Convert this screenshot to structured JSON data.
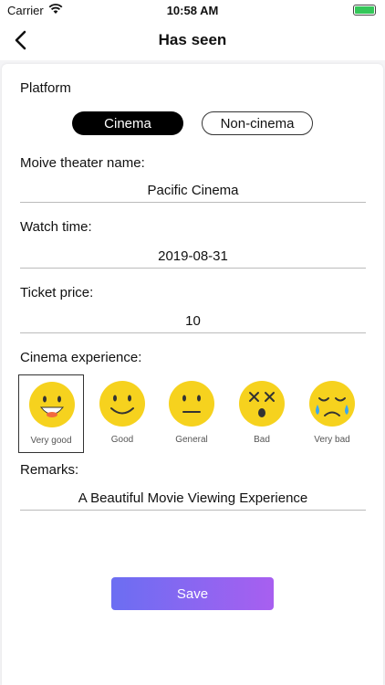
{
  "status": {
    "carrier": "Carrier",
    "time": "10:58 AM"
  },
  "nav": {
    "title": "Has seen"
  },
  "form": {
    "platform_label": "Platform",
    "platform_options": [
      "Cinema",
      "Non-cinema"
    ],
    "theater_label": "Moive theater name:",
    "theater_value": "Pacific Cinema",
    "watch_time_label": "Watch time:",
    "watch_time_value": "2019-08-31",
    "price_label": "Ticket price:",
    "price_value": "10",
    "experience_label": "Cinema experience:",
    "experiences": [
      "Very good",
      "Good",
      "General",
      "Bad",
      "Very bad"
    ],
    "remarks_label": "Remarks:",
    "remarks_value": "A Beautiful Movie Viewing Experience",
    "save_label": "Save"
  },
  "colors": {
    "accent_start": "#6b6ef2",
    "accent_end": "#a85ff0",
    "emoji": "#f6d21e",
    "battery": "#34c759"
  }
}
